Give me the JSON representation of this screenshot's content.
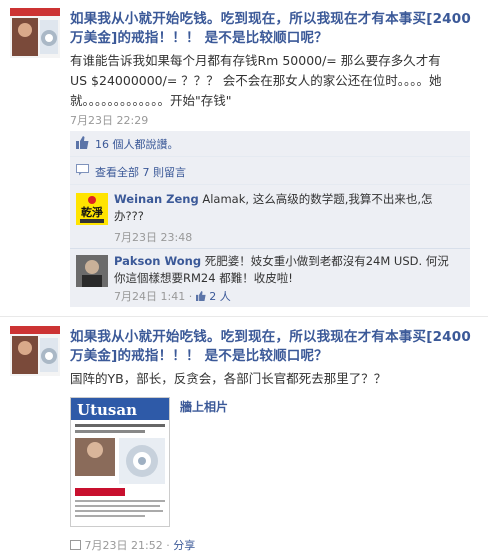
{
  "post1": {
    "title": "如果我从小就开始吃钱。吃到现在，所以我现在才有本事买[2400万美金]的戒指！！！ 是不是比较顺口呢？",
    "body": "有谁能告诉我如果每个月都有存钱Rm 50000/= 那么要存多久才有US $24000000/= ？？？ 会不会在那女人的家公还在位时。。。。她就。。。。。。。。。。。。。开始\"存钱\"",
    "timestamp": "7月23日 22:29",
    "likes_text": "16 個人都說讚。",
    "view_all_text": "查看全部 7 則留言",
    "comments": [
      {
        "name": "Weinan Zeng",
        "text": "Alamak, 这么高级的数学题,我算不出来也,怎办???",
        "time": "7月23日 23:48",
        "avatar_text": "乾淨"
      },
      {
        "name": "Pakson Wong",
        "text": "死肥婆！妓女重小做到老都沒有24M USD. 何況你這個樣想要RM24 都難！收皮啦!",
        "time": "7月24日 1:41",
        "sep": "·",
        "likes": "2 人"
      }
    ]
  },
  "post2": {
    "title": "如果我从小就开始吃钱。吃到现在，所以我现在才有本事买[2400万美金]的戒指！！！ 是不是比较顺口呢？",
    "body": "国阵的YB，部长，反贪会，各部门长官都死去那里了？？",
    "album_link": "牆上相片",
    "photo_masthead": "Utusan",
    "timestamp": "7月23日 21:52",
    "sep": "·",
    "share": "分享"
  },
  "colors": {
    "link": "#3b5998",
    "ufi_bg": "#edeff4"
  },
  "icons": [
    "like-thumb-icon",
    "comment-bubble-icon",
    "share-icon"
  ]
}
